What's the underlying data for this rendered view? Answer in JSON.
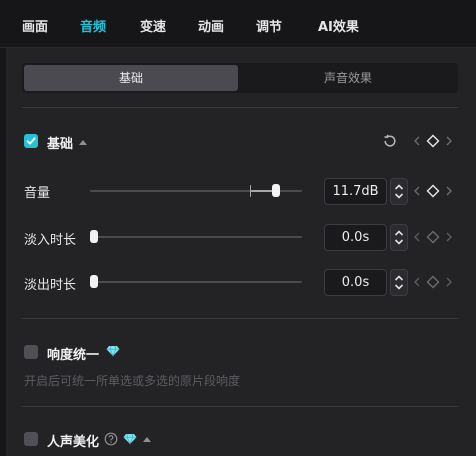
{
  "tabs": [
    {
      "label": "画面",
      "active": false
    },
    {
      "label": "音频",
      "active": true
    },
    {
      "label": "变速",
      "active": false
    },
    {
      "label": "动画",
      "active": false
    },
    {
      "label": "调节",
      "active": false
    },
    {
      "label": "AI效果",
      "active": false
    }
  ],
  "segmented": {
    "items": [
      {
        "label": "基础",
        "active": true
      },
      {
        "label": "声音效果",
        "active": false
      }
    ]
  },
  "basic_section": {
    "title": "基础",
    "checked": true,
    "rows": [
      {
        "label": "音量",
        "value": "11.7dB",
        "level": 0.86,
        "keyframe_active": true
      },
      {
        "label": "淡入时长",
        "value": "0.0s",
        "level": 0.0,
        "keyframe_active": false
      },
      {
        "label": "淡出时长",
        "value": "0.0s",
        "level": 0.0,
        "keyframe_active": false
      }
    ]
  },
  "loudness_section": {
    "title": "响度统一",
    "checked": false,
    "badge_icon": "diamond-vip-icon",
    "description": "开启后可统一所单选或多选的原片段响度"
  },
  "voice_section": {
    "title": "人声美化",
    "checked": false,
    "help_icon": "question-icon",
    "badge_icon": "diamond-vip-icon"
  },
  "colors": {
    "accent": "#27c1d6",
    "panel": "#232326",
    "background": "#161618"
  }
}
